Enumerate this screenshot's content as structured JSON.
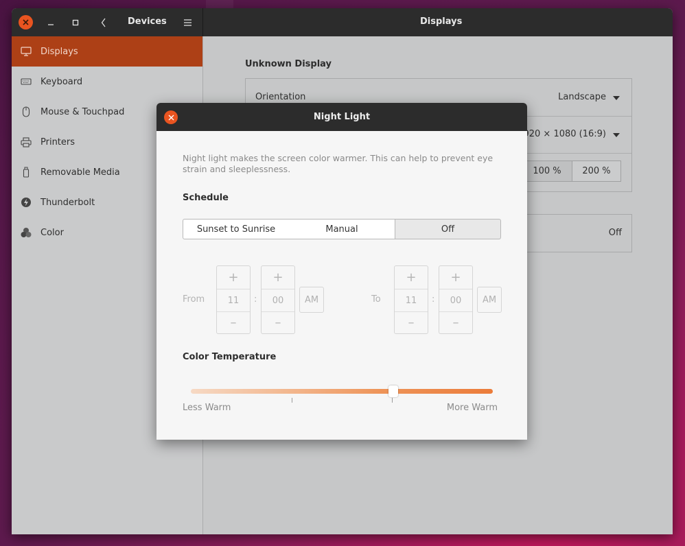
{
  "window": {
    "title_left": "Devices",
    "title_right": "Displays"
  },
  "sidebar": {
    "items": [
      {
        "label": "Displays",
        "icon": "display-icon",
        "active": true
      },
      {
        "label": "Keyboard",
        "icon": "keyboard-icon"
      },
      {
        "label": "Mouse & Touchpad",
        "icon": "mouse-icon"
      },
      {
        "label": "Printers",
        "icon": "printer-icon"
      },
      {
        "label": "Removable Media",
        "icon": "usb-drive-icon"
      },
      {
        "label": "Thunderbolt",
        "icon": "thunderbolt-icon"
      },
      {
        "label": "Color",
        "icon": "color-icon"
      }
    ]
  },
  "content": {
    "section_title": "Unknown Display",
    "orientation_label": "Orientation",
    "orientation_value": "Landscape",
    "resolution_value": "1920 × 1080 (16:9)",
    "scale_options": [
      "100 %",
      "200 %"
    ],
    "night_light_value": "Off"
  },
  "dialog": {
    "title": "Night Light",
    "description": "Night light makes the screen color warmer. This can help to prevent eye strain and sleeplessness.",
    "schedule_heading": "Schedule",
    "schedule_options": [
      "Sunset to Sunrise",
      "Manual",
      "Off"
    ],
    "schedule_selected": "Off",
    "from_label": "From",
    "to_label": "To",
    "from_hour": "11",
    "from_minute": "00",
    "from_ampm": "AM",
    "to_hour": "11",
    "to_minute": "00",
    "to_ampm": "AM",
    "separator": ":",
    "plus": "+",
    "minus": "–",
    "temperature_heading": "Color Temperature",
    "less_warm": "Less Warm",
    "more_warm": "More Warm",
    "temperature_level": 0.67
  },
  "colors": {
    "accent": "#e95420",
    "sidebar_active": "#ad4016",
    "titlebar": "#2c2c2c"
  }
}
